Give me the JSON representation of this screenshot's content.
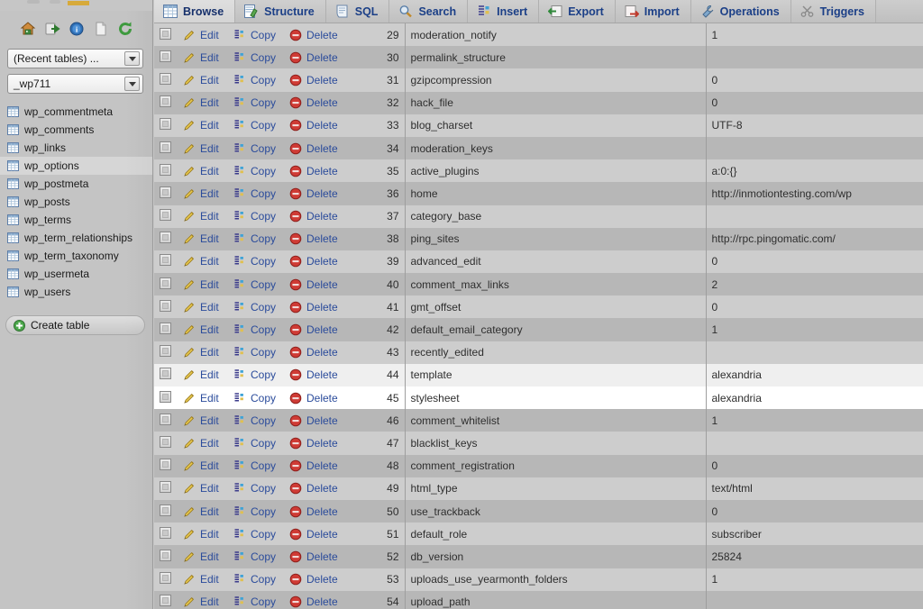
{
  "app": {
    "title": "phpMyAdmin"
  },
  "sidebar": {
    "icons": [
      {
        "name": "home-icon",
        "label": "Home"
      },
      {
        "name": "logout-icon",
        "label": "Log out"
      },
      {
        "name": "help-icon",
        "label": "phpMyAdmin documentation"
      },
      {
        "name": "docs-icon",
        "label": "Documentation"
      },
      {
        "name": "reload-icon",
        "label": "Reload navigation"
      }
    ],
    "recent_select": {
      "value": "(Recent tables) ...",
      "icon": "chevron-down-icon"
    },
    "database_select": {
      "value": "_wp711",
      "icon": "chevron-down-icon"
    },
    "tables": [
      {
        "label": "wp_commentmeta",
        "active": false
      },
      {
        "label": "wp_comments",
        "active": false
      },
      {
        "label": "wp_links",
        "active": false
      },
      {
        "label": "wp_options",
        "active": true
      },
      {
        "label": "wp_postmeta",
        "active": false
      },
      {
        "label": "wp_posts",
        "active": false
      },
      {
        "label": "wp_terms",
        "active": false
      },
      {
        "label": "wp_term_relationships",
        "active": false
      },
      {
        "label": "wp_term_taxonomy",
        "active": false
      },
      {
        "label": "wp_usermeta",
        "active": false
      },
      {
        "label": "wp_users",
        "active": false
      }
    ],
    "create_table": {
      "label": "Create table",
      "icon": "plus-circle-icon"
    }
  },
  "tabs": [
    {
      "label": "Browse",
      "icon": "browse-icon",
      "active": true
    },
    {
      "label": "Structure",
      "icon": "structure-icon",
      "active": false
    },
    {
      "label": "SQL",
      "icon": "sql-icon",
      "active": false
    },
    {
      "label": "Search",
      "icon": "search-icon",
      "active": false
    },
    {
      "label": "Insert",
      "icon": "insert-icon",
      "active": false
    },
    {
      "label": "Export",
      "icon": "export-icon",
      "active": false
    },
    {
      "label": "Import",
      "icon": "import-icon",
      "active": false
    },
    {
      "label": "Operations",
      "icon": "operations-icon",
      "active": false
    },
    {
      "label": "Triggers",
      "icon": "triggers-icon",
      "active": false
    }
  ],
  "actions": {
    "edit": "Edit",
    "copy": "Copy",
    "delete": "Delete"
  },
  "rows": [
    {
      "id": "29",
      "name": "moderation_notify",
      "value": "1",
      "state": "odd"
    },
    {
      "id": "30",
      "name": "permalink_structure",
      "value": "",
      "state": "even"
    },
    {
      "id": "31",
      "name": "gzipcompression",
      "value": "0",
      "state": "odd"
    },
    {
      "id": "32",
      "name": "hack_file",
      "value": "0",
      "state": "even"
    },
    {
      "id": "33",
      "name": "blog_charset",
      "value": "UTF-8",
      "state": "odd"
    },
    {
      "id": "34",
      "name": "moderation_keys",
      "value": "",
      "state": "even"
    },
    {
      "id": "35",
      "name": "active_plugins",
      "value": "a:0:{}",
      "state": "odd"
    },
    {
      "id": "36",
      "name": "home",
      "value": "http://inmotiontesting.com/wp",
      "state": "even"
    },
    {
      "id": "37",
      "name": "category_base",
      "value": "",
      "state": "odd"
    },
    {
      "id": "38",
      "name": "ping_sites",
      "value": "http://rpc.pingomatic.com/",
      "state": "even"
    },
    {
      "id": "39",
      "name": "advanced_edit",
      "value": "0",
      "state": "odd"
    },
    {
      "id": "40",
      "name": "comment_max_links",
      "value": "2",
      "state": "even"
    },
    {
      "id": "41",
      "name": "gmt_offset",
      "value": "0",
      "state": "odd"
    },
    {
      "id": "42",
      "name": "default_email_category",
      "value": "1",
      "state": "even"
    },
    {
      "id": "43",
      "name": "recently_edited",
      "value": "",
      "state": "odd"
    },
    {
      "id": "44",
      "name": "template",
      "value": "alexandria",
      "state": "marked"
    },
    {
      "id": "45",
      "name": "stylesheet",
      "value": "alexandria",
      "state": "hovered"
    },
    {
      "id": "46",
      "name": "comment_whitelist",
      "value": "1",
      "state": "even"
    },
    {
      "id": "47",
      "name": "blacklist_keys",
      "value": "",
      "state": "odd"
    },
    {
      "id": "48",
      "name": "comment_registration",
      "value": "0",
      "state": "even"
    },
    {
      "id": "49",
      "name": "html_type",
      "value": "text/html",
      "state": "odd"
    },
    {
      "id": "50",
      "name": "use_trackback",
      "value": "0",
      "state": "even"
    },
    {
      "id": "51",
      "name": "default_role",
      "value": "subscriber",
      "state": "odd"
    },
    {
      "id": "52",
      "name": "db_version",
      "value": "25824",
      "state": "even"
    },
    {
      "id": "53",
      "name": "uploads_use_yearmonth_folders",
      "value": "1",
      "state": "odd"
    },
    {
      "id": "54",
      "name": "upload_path",
      "value": "",
      "state": "even"
    }
  ],
  "colors": {
    "link": "#2a4b9b",
    "tab_text": "#1b3f87",
    "row_odd": "#cdcdcd",
    "row_even": "#b7b7b7",
    "row_marked": "#efefef",
    "row_hover": "#ffffff",
    "sidebar_bg": "#c4c4c4",
    "accent_orange": "#d9a521"
  }
}
